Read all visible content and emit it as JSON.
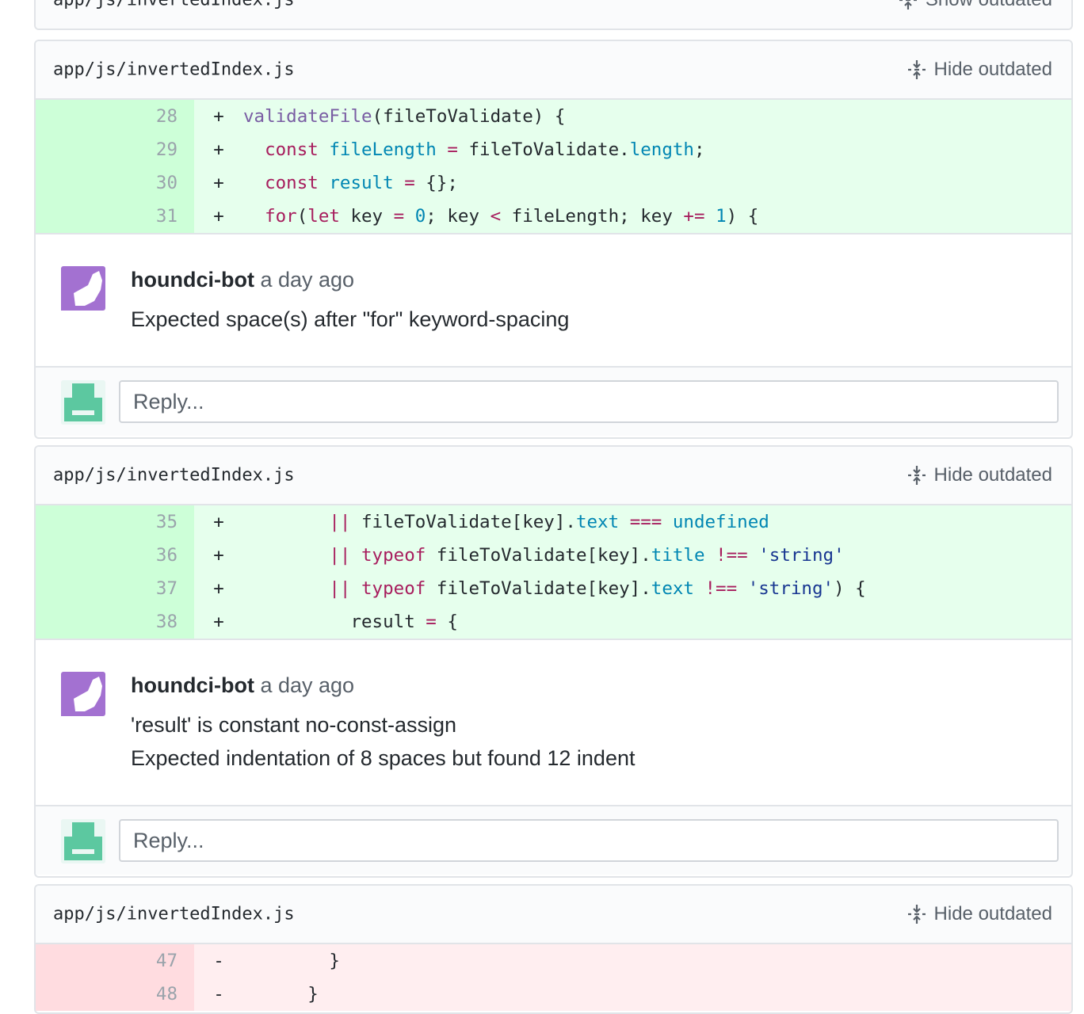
{
  "top_partial": {
    "filename": "app/js/invertedIndex.js",
    "toggle_label": "Show outdated"
  },
  "threads": [
    {
      "filename": "app/js/invertedIndex.js",
      "toggle_label": "Hide outdated",
      "lines": [
        {
          "num": "28",
          "sign": "+"
        },
        {
          "num": "29",
          "sign": "+"
        },
        {
          "num": "30",
          "sign": "+"
        },
        {
          "num": "31",
          "sign": "+"
        }
      ],
      "comment": {
        "author": "houndci-bot",
        "time": "a day ago",
        "lines": [
          "Expected space(s) after \"for\" keyword-spacing"
        ]
      },
      "reply_placeholder": "Reply..."
    },
    {
      "filename": "app/js/invertedIndex.js",
      "toggle_label": "Hide outdated",
      "lines": [
        {
          "num": "35",
          "sign": "+"
        },
        {
          "num": "36",
          "sign": "+"
        },
        {
          "num": "37",
          "sign": "+"
        },
        {
          "num": "38",
          "sign": "+"
        }
      ],
      "comment": {
        "author": "houndci-bot",
        "time": "a day ago",
        "lines": [
          "'result' is constant no-const-assign",
          "Expected indentation of 8 spaces but found 12 indent"
        ]
      },
      "reply_placeholder": "Reply..."
    },
    {
      "filename": "app/js/invertedIndex.js",
      "toggle_label": "Hide outdated",
      "lines": [
        {
          "num": "47",
          "sign": "-"
        },
        {
          "num": "48",
          "sign": "-"
        }
      ]
    }
  ],
  "code": {
    "t1_l28": [
      {
        "t": "validateFile",
        "c": "f"
      },
      {
        "t": "(fileToValidate) {",
        "c": "p"
      }
    ],
    "t1_l29": [
      {
        "t": "  ",
        "c": "p"
      },
      {
        "t": "const",
        "c": "k"
      },
      {
        "t": " ",
        "c": "p"
      },
      {
        "t": "fileLength",
        "c": "c"
      },
      {
        "t": " ",
        "c": "p"
      },
      {
        "t": "=",
        "c": "k"
      },
      {
        "t": " fileToValidate.",
        "c": "p"
      },
      {
        "t": "length",
        "c": "c"
      },
      {
        "t": ";",
        "c": "p"
      }
    ],
    "t1_l30": [
      {
        "t": "  ",
        "c": "p"
      },
      {
        "t": "const",
        "c": "k"
      },
      {
        "t": " ",
        "c": "p"
      },
      {
        "t": "result",
        "c": "c"
      },
      {
        "t": " ",
        "c": "p"
      },
      {
        "t": "=",
        "c": "k"
      },
      {
        "t": " {};",
        "c": "p"
      }
    ],
    "t1_l31": [
      {
        "t": "  ",
        "c": "p"
      },
      {
        "t": "for",
        "c": "k"
      },
      {
        "t": "(",
        "c": "p"
      },
      {
        "t": "let",
        "c": "k"
      },
      {
        "t": " key ",
        "c": "p"
      },
      {
        "t": "=",
        "c": "k"
      },
      {
        "t": " ",
        "c": "p"
      },
      {
        "t": "0",
        "c": "c"
      },
      {
        "t": "; key ",
        "c": "p"
      },
      {
        "t": "<",
        "c": "k"
      },
      {
        "t": " fileLength; key ",
        "c": "p"
      },
      {
        "t": "+=",
        "c": "k"
      },
      {
        "t": " ",
        "c": "p"
      },
      {
        "t": "1",
        "c": "c"
      },
      {
        "t": ") {",
        "c": "p"
      }
    ],
    "t2_l35": [
      {
        "t": "        ",
        "c": "p"
      },
      {
        "t": "||",
        "c": "k"
      },
      {
        "t": " fileToValidate[key].",
        "c": "p"
      },
      {
        "t": "text",
        "c": "c"
      },
      {
        "t": " ",
        "c": "p"
      },
      {
        "t": "===",
        "c": "k"
      },
      {
        "t": " ",
        "c": "p"
      },
      {
        "t": "undefined",
        "c": "c"
      }
    ],
    "t2_l36": [
      {
        "t": "        ",
        "c": "p"
      },
      {
        "t": "||",
        "c": "k"
      },
      {
        "t": " ",
        "c": "p"
      },
      {
        "t": "typeof",
        "c": "k"
      },
      {
        "t": " fileToValidate[key].",
        "c": "p"
      },
      {
        "t": "title",
        "c": "c"
      },
      {
        "t": " ",
        "c": "p"
      },
      {
        "t": "!==",
        "c": "k"
      },
      {
        "t": " ",
        "c": "p"
      },
      {
        "t": "'string'",
        "c": "s"
      }
    ],
    "t2_l37": [
      {
        "t": "        ",
        "c": "p"
      },
      {
        "t": "||",
        "c": "k"
      },
      {
        "t": " ",
        "c": "p"
      },
      {
        "t": "typeof",
        "c": "k"
      },
      {
        "t": " fileToValidate[key].",
        "c": "p"
      },
      {
        "t": "text",
        "c": "c"
      },
      {
        "t": " ",
        "c": "p"
      },
      {
        "t": "!==",
        "c": "k"
      },
      {
        "t": " ",
        "c": "p"
      },
      {
        "t": "'string'",
        "c": "s"
      },
      {
        "t": ") {",
        "c": "p"
      }
    ],
    "t2_l38": [
      {
        "t": "          result ",
        "c": "p"
      },
      {
        "t": "=",
        "c": "k"
      },
      {
        "t": " {",
        "c": "p"
      }
    ],
    "t3_l47": [
      {
        "t": "        }",
        "c": "p"
      }
    ],
    "t3_l48": [
      {
        "t": "      }",
        "c": "p"
      }
    ]
  },
  "colors": {
    "addition_bg": "#e6ffed",
    "deletion_bg": "#ffeef0",
    "bot_avatar": "#a371d1",
    "user_avatar": "#5cc8a0"
  }
}
